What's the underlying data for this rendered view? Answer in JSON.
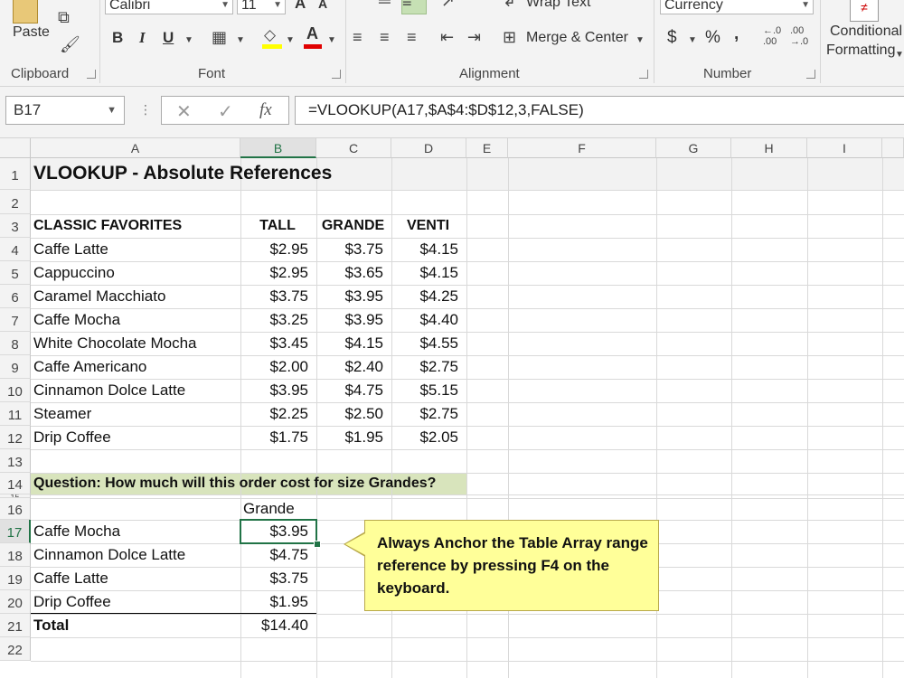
{
  "ribbon": {
    "clipboard": {
      "label": "Clipboard",
      "paste": "Paste"
    },
    "font": {
      "label": "Font",
      "name": "Calibri",
      "size": "11",
      "bold": "B",
      "italic": "I",
      "underline": "U",
      "grow": "A",
      "shrink": "A"
    },
    "alignment": {
      "label": "Alignment",
      "wrap_text": "Wrap Text",
      "merge_center": "Merge & Center"
    },
    "number": {
      "label": "Number",
      "format": "Currency",
      "dollar": "$",
      "percent": "%",
      "comma": ",",
      "inc_decimal": ".00",
      "dec_decimal": ".00"
    },
    "styles": {
      "conditional": "Conditional",
      "formatting": "Formatting"
    }
  },
  "formula_bar": {
    "name_box": "B17",
    "fx": "fx",
    "cancel": "✕",
    "enter": "✓",
    "formula": "=VLOOKUP(A17,$A$4:$D$12,3,FALSE)"
  },
  "columns": [
    "A",
    "B",
    "C",
    "D",
    "E",
    "F",
    "G",
    "H",
    "I"
  ],
  "rows": [
    "1",
    "2",
    "3",
    "4",
    "5",
    "6",
    "7",
    "8",
    "9",
    "10",
    "11",
    "12",
    "13",
    "14",
    "15",
    "16",
    "17",
    "18",
    "19",
    "20",
    "21",
    "22"
  ],
  "sheet": {
    "title": "VLOOKUP - Absolute References",
    "header": [
      "CLASSIC FAVORITES",
      "TALL",
      "GRANDE",
      "VENTI"
    ],
    "menu": [
      [
        "Caffe Latte",
        "$2.95",
        "$3.75",
        "$4.15"
      ],
      [
        "Cappuccino",
        "$2.95",
        "$3.65",
        "$4.15"
      ],
      [
        "Caramel Macchiato",
        "$3.75",
        "$3.95",
        "$4.25"
      ],
      [
        "Caffe Mocha",
        "$3.25",
        "$3.95",
        "$4.40"
      ],
      [
        "White Chocolate Mocha",
        "$3.45",
        "$4.15",
        "$4.55"
      ],
      [
        "Caffe Americano",
        "$2.00",
        "$2.40",
        "$2.75"
      ],
      [
        "Cinnamon Dolce Latte",
        "$3.95",
        "$4.75",
        "$5.15"
      ],
      [
        "Steamer",
        "$2.25",
        "$2.50",
        "$2.75"
      ],
      [
        "Drip Coffee",
        "$1.75",
        "$1.95",
        "$2.05"
      ]
    ],
    "question": "Question: How much will this order cost for size Grandes?",
    "order_header": "Grande",
    "order": [
      [
        "Caffe Mocha",
        "$3.95"
      ],
      [
        "Cinnamon Dolce Latte",
        "$4.75"
      ],
      [
        "Caffe Latte",
        "$3.75"
      ],
      [
        "Drip Coffee",
        "$1.95"
      ]
    ],
    "total_label": "Total",
    "total_value": "$14.40"
  },
  "callout": "Always Anchor the Table Array range reference by pressing F4 on the keyboard.",
  "colors": {
    "accent": "#217346",
    "question_fill": "#d8e4bc",
    "callout_fill": "#ffff99"
  }
}
